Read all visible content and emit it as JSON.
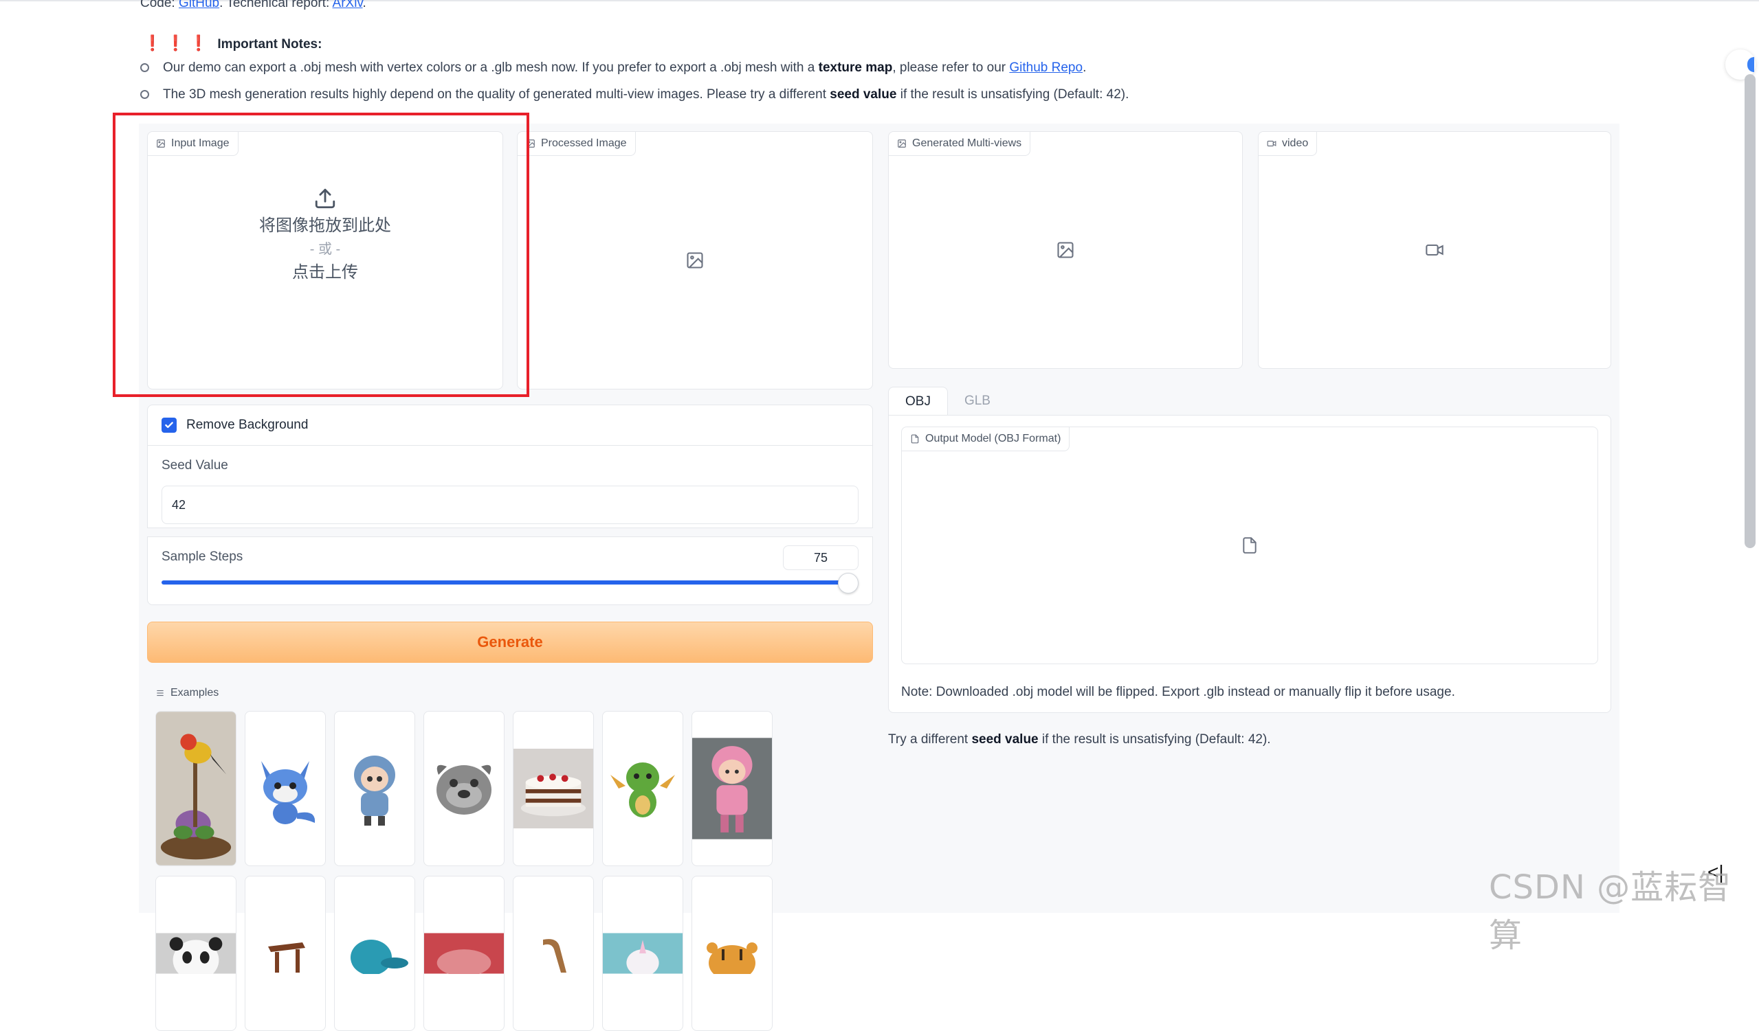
{
  "header": {
    "code_prefix": "Code: ",
    "github_link": "GitHub",
    "report_prefix": ". Techenical report: ",
    "arxiv_link": "ArXiv",
    "period": "."
  },
  "notes": {
    "icons": "❗ ❗ ❗",
    "title": "Important Notes:",
    "note1_a": "Our demo can export a .obj mesh with vertex colors or a .glb mesh now. If you prefer to export a .obj mesh with a ",
    "note1_bold": "texture map",
    "note1_b": ", please refer to our ",
    "note1_link": "Github Repo",
    "note1_c": ".",
    "note2_a": "The 3D mesh generation results highly depend on the quality of generated multi-view images. Please try a different ",
    "note2_bold": "seed value",
    "note2_b": " if the result is unsatisfying (Default: 42)."
  },
  "input_image": {
    "label": "Input Image",
    "drop_text": "将图像拖放到此处",
    "or_text": "- 或 -",
    "click_text": "点击上传"
  },
  "processed_image": {
    "label": "Processed Image"
  },
  "multiviews": {
    "label": "Generated Multi-views"
  },
  "video": {
    "label": "video"
  },
  "settings": {
    "remove_bg_label": "Remove Background",
    "remove_bg_checked": true,
    "seed_label": "Seed Value",
    "seed_value": "42",
    "steps_label": "Sample Steps",
    "steps_value": "75"
  },
  "generate_label": "Generate",
  "examples_label": "Examples",
  "output": {
    "tabs": [
      "OBJ",
      "GLB"
    ],
    "model_label": "Output Model (OBJ Format)",
    "note": "Note: Downloaded .obj model will be flipped. Export .glb instead or manually flip it before usage."
  },
  "try": {
    "a": "Try a different ",
    "bold": "seed value",
    "b": " if the result is unsatisfying (Default: 42)."
  },
  "watermark": "CSDN @蓝耘智算",
  "collapse_icon": "<|",
  "colors": {
    "accent": "#2563eb",
    "generate": "#ea580c",
    "highlight_box": "#e8202a"
  }
}
